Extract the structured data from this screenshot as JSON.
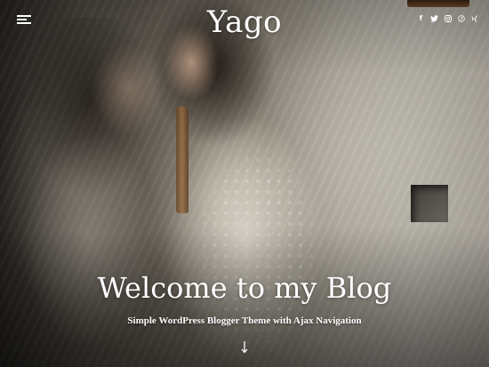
{
  "header": {
    "site_title": "Yago",
    "menu_icon": "hamburger-menu-icon",
    "social": [
      {
        "name": "facebook",
        "glyph": "f"
      },
      {
        "name": "twitter",
        "glyph": ""
      },
      {
        "name": "instagram",
        "glyph": ""
      },
      {
        "name": "pinterest",
        "glyph": ""
      },
      {
        "name": "xing",
        "glyph": ""
      }
    ]
  },
  "hero": {
    "title": "Welcome to my Blog",
    "subtitle": "Simple WordPress Blogger Theme with Ajax Navigation",
    "scroll_icon": "arrow-down-icon"
  },
  "colors": {
    "text": "#ffffff",
    "frame_wood": "#7a5230"
  }
}
